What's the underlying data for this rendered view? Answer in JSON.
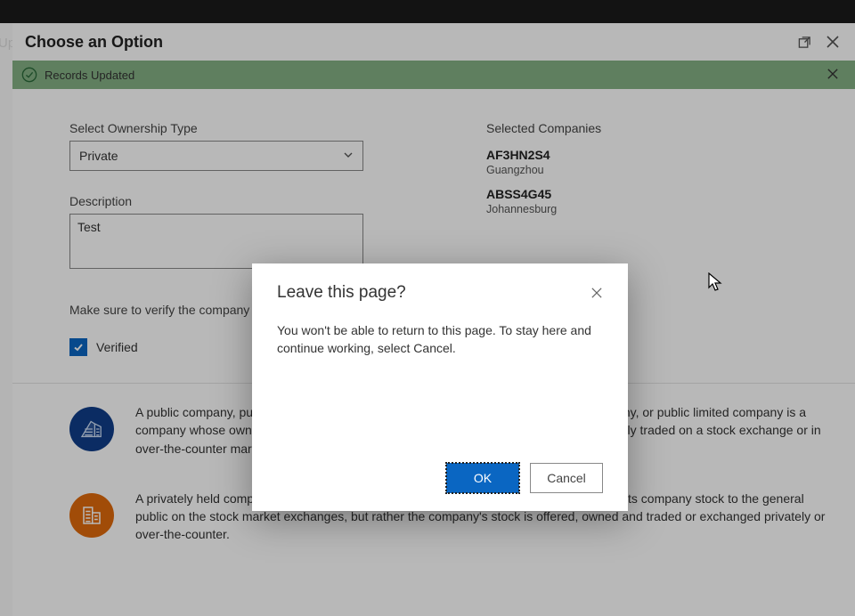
{
  "truncated_label": "Up",
  "panel": {
    "title": "Choose an Option",
    "toast": "Records Updated"
  },
  "form": {
    "ownership_label": "Select Ownership Type",
    "ownership_value": "Private",
    "description_label": "Description",
    "description_value": "Test",
    "verify_note": "Make sure to verify the company",
    "verified_label": "Verified"
  },
  "selected": {
    "label": "Selected Companies",
    "companies": [
      {
        "code": "AF3HN2S4",
        "city": "Guangzhou"
      },
      {
        "code": "ABSS4G45",
        "city": "Johannesburg"
      }
    ]
  },
  "blurbs": {
    "public": "A public company, publicly traded company, publicly held company, publicly listed company, or public limited company is a company whose ownership is organized via shares of stock which are intended to be freely traded on a stock exchange or in over-the-counter markets.",
    "private": "A privately held company or private company is a company which does not offer or trade its company stock to the general public on the stock market exchanges, but rather the company's stock is offered, owned and traded or exchanged privately or over-the-counter."
  },
  "dialog": {
    "title": "Leave this page?",
    "body": "You won't be able to return to this page. To stay here and continue working, select Cancel.",
    "ok": "OK",
    "cancel": "Cancel"
  }
}
